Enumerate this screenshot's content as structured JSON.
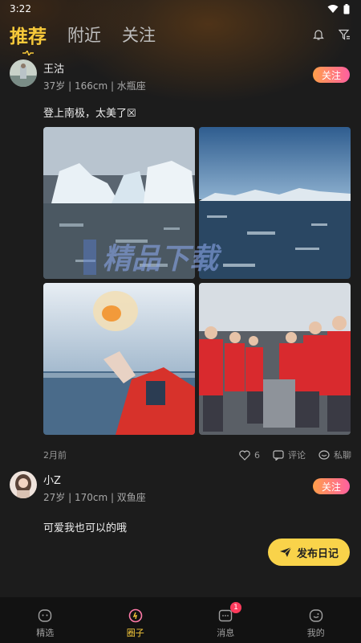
{
  "status": {
    "time": "3:22"
  },
  "header": {
    "tabs": [
      {
        "label": "推荐",
        "active": true
      },
      {
        "label": "附近",
        "active": false
      },
      {
        "label": "关注",
        "active": false
      }
    ],
    "icons": [
      "bell-icon",
      "filter-icon"
    ]
  },
  "posts": [
    {
      "name": "王沽",
      "meta": "37岁 | 166cm | 水瓶座",
      "follow_label": "关注",
      "text": "登上南极，太美了☒",
      "photos": [
        "iceberg",
        "mountains",
        "crystal-hand",
        "red-jackets-group"
      ],
      "time": "2月前",
      "likes": "6",
      "comment_label": "评论",
      "chat_label": "私聊"
    },
    {
      "name": "小Z",
      "meta": "27岁 | 170cm | 双鱼座",
      "follow_label": "关注",
      "text": "可爱我也可以的哦"
    }
  ],
  "watermark": "精品下载",
  "publish": {
    "label": "发布日记"
  },
  "bottom_nav": [
    {
      "label": "精选",
      "icon": "smile-icon",
      "active": false
    },
    {
      "label": "圈子",
      "icon": "circle-icon",
      "active": true
    },
    {
      "label": "消息",
      "icon": "message-icon",
      "active": false,
      "badge": "1"
    },
    {
      "label": "我的",
      "icon": "profile-icon",
      "active": false
    }
  ],
  "colors": {
    "accent": "#f7c93a",
    "follow_from": "#ff9f4a",
    "follow_to": "#ff5fa0",
    "background": "#1c1c1c"
  }
}
